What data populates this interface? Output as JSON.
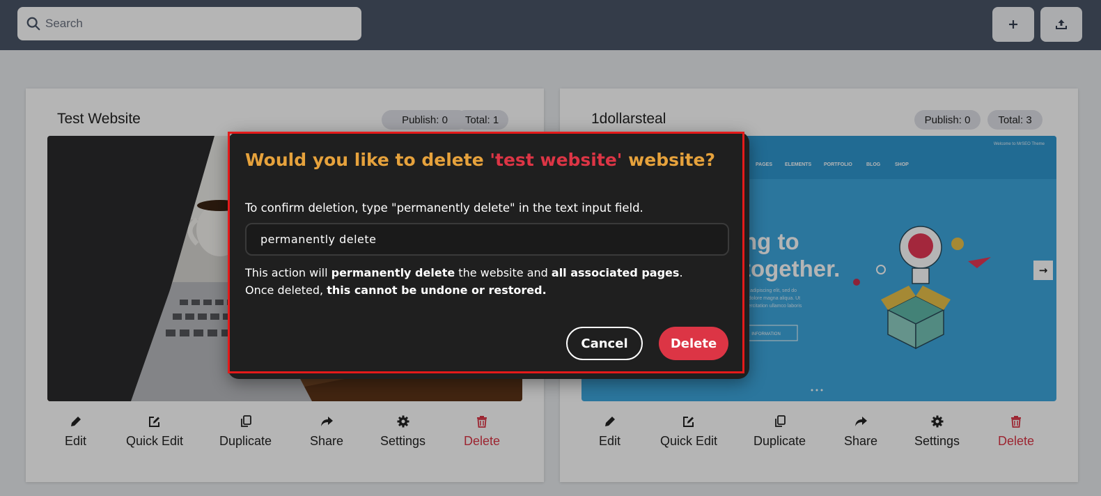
{
  "search": {
    "placeholder": "Search"
  },
  "toolbar": {
    "add_icon": "plus-icon",
    "upload_icon": "upload-icon"
  },
  "cards": [
    {
      "title": "Test Website",
      "publish": "Publish: 0",
      "total": "Total: 1",
      "thumbnail": "laptop-and-coffee-mug-photo"
    },
    {
      "title": "1dollarsteal",
      "publish": "Publish: 0",
      "total": "Total: 3",
      "thumbnail": "website-theme-preview",
      "preview": {
        "topline": "Welcome to MrSEO Theme",
        "nav": [
          "PAGES",
          "ELEMENTS",
          "PORTFOLIO",
          "BLOG",
          "SHOP"
        ],
        "hero_line1": "ng to",
        "hero_line2": "together.",
        "body1": "tur adipiscing elit, sed do",
        "body2": "et dolore magna aliqua. Ut",
        "body3": "exercitation ullamco laboris",
        "cta": "INFORMATION",
        "arrow": "→"
      }
    }
  ],
  "actions": [
    "Edit",
    "Quick Edit",
    "Duplicate",
    "Share",
    "Settings",
    "Delete"
  ],
  "modal": {
    "title_prefix": "Would you like to delete ",
    "title_name": "'test website'",
    "title_suffix": " website?",
    "instruction": "To confirm deletion, type \"permanently delete\" in the text input field.",
    "input_value": "permanently delete",
    "warn_line1_a": "This action will ",
    "warn_line1_b": "permanently delete",
    "warn_line1_c": " the website and ",
    "warn_line1_d": "all associated pages",
    "warn_line1_e": ".",
    "warn_line2_a": "Once deleted, ",
    "warn_line2_b": "this cannot be undone or restored.",
    "cancel": "Cancel",
    "delete": "Delete"
  },
  "colors": {
    "topbar": "#4a5568",
    "accent": "#e6a23c",
    "danger": "#dc3545",
    "modal_bg": "#1f1f1f",
    "highlight": "#e41a1a"
  }
}
